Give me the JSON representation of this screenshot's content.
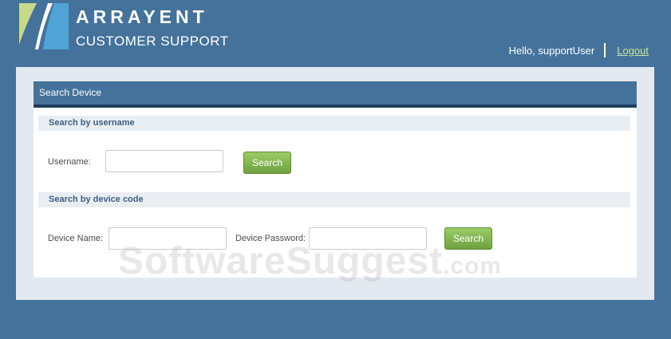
{
  "header": {
    "brand": "ARRAYENT",
    "subtitle": "CUSTOMER SUPPORT",
    "greeting": "Hello, supportUser",
    "logout_label": "Logout"
  },
  "search_panel": {
    "title": "Search Device",
    "by_username": {
      "heading": "Search by username",
      "username_label": "Username:",
      "username_value": "",
      "search_label": "Search"
    },
    "by_device_code": {
      "heading": "Search by device code",
      "device_name_label": "Device Name:",
      "device_name_value": "",
      "device_password_label": "Device Password:",
      "device_password_value": "",
      "search_label": "Search"
    }
  },
  "watermark": {
    "main": "SoftwareSuggest",
    "suffix": ".com"
  },
  "colors": {
    "background": "#44729b",
    "panel_header": "#44729b",
    "panel_header_border": "#1e3f5e",
    "button_green": "#7fb14d",
    "logout_link": "#c9e5a0"
  }
}
